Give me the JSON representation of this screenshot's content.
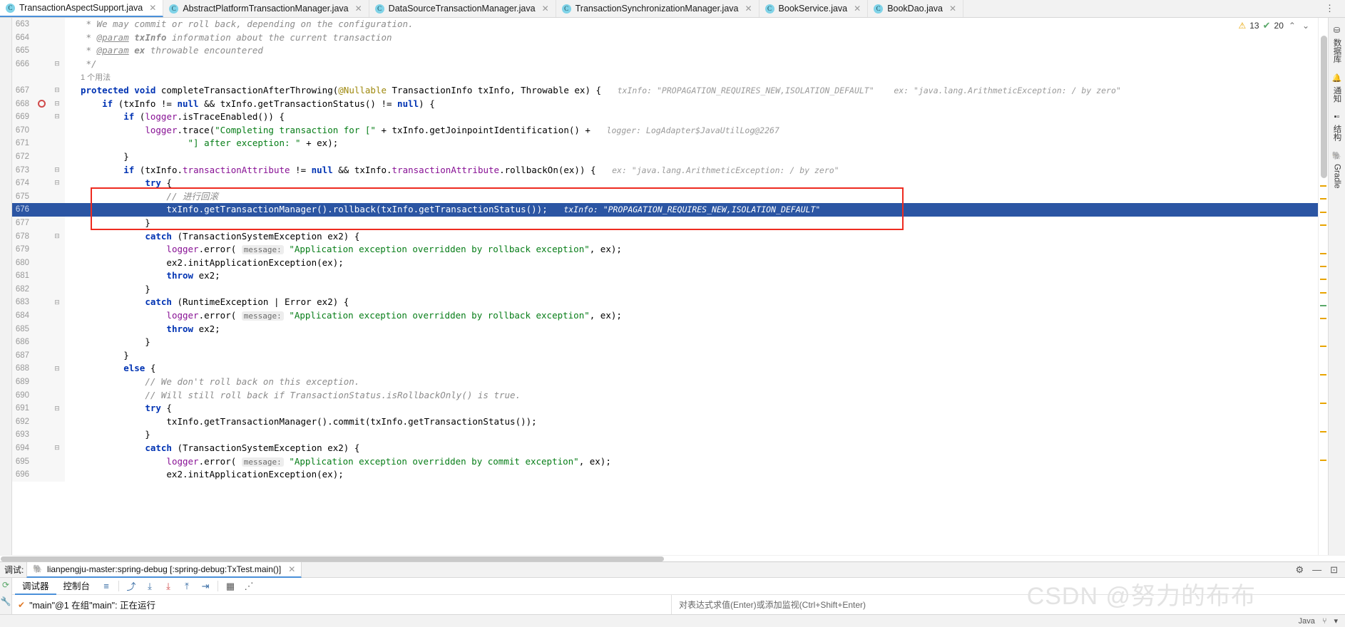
{
  "tabs": [
    {
      "label": "TransactionAspectSupport.java",
      "icon": "java-class-icon",
      "active": true
    },
    {
      "label": "AbstractPlatformTransactionManager.java",
      "icon": "java-class-icon",
      "active": false
    },
    {
      "label": "DataSourceTransactionManager.java",
      "icon": "java-class-icon",
      "active": false
    },
    {
      "label": "TransactionSynchronizationManager.java",
      "icon": "java-class-icon",
      "active": false
    },
    {
      "label": "BookService.java",
      "icon": "java-class-icon",
      "active": false
    },
    {
      "label": "BookDao.java",
      "icon": "java-class-icon",
      "active": false
    }
  ],
  "inspection": {
    "warning_count": "13",
    "check_count": "20",
    "warning_icon": "warning-triangle-icon",
    "check_icon": "green-check-icon",
    "prev_icon": "chevron-up-icon",
    "next_icon": "chevron-down-icon"
  },
  "right_rail": [
    {
      "label": "数据库",
      "icon": "database-icon"
    },
    {
      "label": "通知",
      "icon": "bell-icon"
    },
    {
      "label": "结构",
      "icon": "structure-icon"
    },
    {
      "label": "Gradle",
      "icon": "gradle-elephant-icon"
    }
  ],
  "editor": {
    "usage_hint": "1 个用法",
    "lines": [
      {
        "num": "663",
        "fold": "",
        "bp": false,
        "hl": false,
        "indent": 0,
        "html": "<span class=\"doc\"> * We may commit or roll back, depending on the configuration.</span>"
      },
      {
        "num": "664",
        "fold": "",
        "bp": false,
        "hl": false,
        "indent": 0,
        "html": "<span class=\"doc\"> * <span class=\"param-u\">@param</span> <b>txInfo</b> information about the current transaction</span>"
      },
      {
        "num": "665",
        "fold": "",
        "bp": false,
        "hl": false,
        "indent": 0,
        "html": "<span class=\"doc\"> * <span class=\"param-u\">@param</span> <b>ex</b> throwable encountered</span>"
      },
      {
        "num": "666",
        "fold": "minus",
        "bp": false,
        "hl": false,
        "indent": 0,
        "html": "<span class=\"doc\"> */</span>"
      },
      {
        "num": "",
        "fold": "",
        "bp": false,
        "hl": false,
        "indent": 0,
        "usage": true,
        "html": "<span class=\"usage\">1 个用法</span>"
      },
      {
        "num": "667",
        "fold": "minus",
        "bp": false,
        "hl": false,
        "indent": 0,
        "html": "<span class=\"kw\">protected</span> <span class=\"kw\">void</span> <span class=\"mth\">completeTransactionAfterThrowing</span>(<span class=\"anno\">@Nullable</span> TransactionInfo txInfo, Throwable ex) {   <span class=\"hint\">txInfo: \"PROPAGATION_REQUIRES_NEW,ISOLATION_DEFAULT\"    ex: \"java.lang.ArithmeticException: / by zero\"</span>"
      },
      {
        "num": "668",
        "fold": "minus",
        "bp": true,
        "hl": false,
        "indent": 1,
        "html": "    <span class=\"kw\">if</span> (txInfo != <span class=\"kw\">null</span> &amp;&amp; txInfo.getTransactionStatus() != <span class=\"kw\">null</span>) {"
      },
      {
        "num": "669",
        "fold": "minus",
        "bp": false,
        "hl": false,
        "indent": 2,
        "html": "        <span class=\"kw\">if</span> (<span class=\"fld\">logger</span>.isTraceEnabled()) {"
      },
      {
        "num": "670",
        "fold": "",
        "bp": false,
        "hl": false,
        "indent": 3,
        "html": "            <span class=\"fld\">logger</span>.trace(<span class=\"str\">\"Completing transaction for [\"</span> + txInfo.getJoinpointIdentification() +   <span class=\"hint\">logger: LogAdapter$JavaUtilLog@2267</span>"
      },
      {
        "num": "671",
        "fold": "",
        "bp": false,
        "hl": false,
        "indent": 3,
        "html": "                    <span class=\"str\">\"] after exception: \"</span> + ex);"
      },
      {
        "num": "672",
        "fold": "",
        "bp": false,
        "hl": false,
        "indent": 2,
        "html": "        }"
      },
      {
        "num": "673",
        "fold": "minus",
        "bp": false,
        "hl": false,
        "indent": 2,
        "html": "        <span class=\"kw\">if</span> (txInfo.<span class=\"fld\">transactionAttribute</span> != <span class=\"kw\">null</span> &amp;&amp; txInfo.<span class=\"fld\">transactionAttribute</span>.rollbackOn(ex)) {   <span class=\"hint\">ex: \"java.lang.ArithmeticException: / by zero\"</span>"
      },
      {
        "num": "674",
        "fold": "minus",
        "bp": false,
        "hl": false,
        "indent": 3,
        "html": "            <span class=\"kw\">try</span> {"
      },
      {
        "num": "675",
        "fold": "",
        "bp": false,
        "hl": false,
        "indent": 4,
        "html": "                <span class=\"cmt\">// 进行回滚</span>"
      },
      {
        "num": "676",
        "fold": "",
        "bp": false,
        "hl": true,
        "indent": 4,
        "html": "                txInfo.getTransactionManager().rollback(txInfo.getTransactionStatus());   <span class=\"hint\">txInfo: \"PROPAGATION_REQUIRES_NEW,ISOLATION_DEFAULT\"</span>"
      },
      {
        "num": "677",
        "fold": "",
        "bp": false,
        "hl": false,
        "indent": 3,
        "html": "            }"
      },
      {
        "num": "678",
        "fold": "minus",
        "bp": false,
        "hl": false,
        "indent": 3,
        "html": "            <span class=\"kw\">catch</span> (TransactionSystemException ex2) {"
      },
      {
        "num": "679",
        "fold": "",
        "bp": false,
        "hl": false,
        "indent": 4,
        "html": "                <span class=\"fld\">logger</span>.error( <span class=\"hintbox\">message:</span> <span class=\"str\">\"Application exception overridden by rollback exception\"</span>, ex);"
      },
      {
        "num": "680",
        "fold": "",
        "bp": false,
        "hl": false,
        "indent": 4,
        "html": "                ex2.initApplicationException(ex);"
      },
      {
        "num": "681",
        "fold": "",
        "bp": false,
        "hl": false,
        "indent": 4,
        "html": "                <span class=\"kw\">throw</span> ex2;"
      },
      {
        "num": "682",
        "fold": "",
        "bp": false,
        "hl": false,
        "indent": 3,
        "html": "            }"
      },
      {
        "num": "683",
        "fold": "minus",
        "bp": false,
        "hl": false,
        "indent": 3,
        "html": "            <span class=\"kw\">catch</span> (RuntimeException | Error ex2) {"
      },
      {
        "num": "684",
        "fold": "",
        "bp": false,
        "hl": false,
        "indent": 4,
        "html": "                <span class=\"fld\">logger</span>.error( <span class=\"hintbox\">message:</span> <span class=\"str\">\"Application exception overridden by rollback exception\"</span>, ex);"
      },
      {
        "num": "685",
        "fold": "",
        "bp": false,
        "hl": false,
        "indent": 4,
        "html": "                <span class=\"kw\">throw</span> ex2;"
      },
      {
        "num": "686",
        "fold": "",
        "bp": false,
        "hl": false,
        "indent": 3,
        "html": "            }"
      },
      {
        "num": "687",
        "fold": "",
        "bp": false,
        "hl": false,
        "indent": 2,
        "html": "        }"
      },
      {
        "num": "688",
        "fold": "minus",
        "bp": false,
        "hl": false,
        "indent": 2,
        "html": "        <span class=\"kw\">else</span> {"
      },
      {
        "num": "689",
        "fold": "",
        "bp": false,
        "hl": false,
        "indent": 3,
        "html": "            <span class=\"cmt\">// We don't roll back on this exception.</span>"
      },
      {
        "num": "690",
        "fold": "",
        "bp": false,
        "hl": false,
        "indent": 3,
        "html": "            <span class=\"cmt\">// Will still roll back if TransactionStatus.isRollbackOnly() is true.</span>"
      },
      {
        "num": "691",
        "fold": "minus",
        "bp": false,
        "hl": false,
        "indent": 3,
        "html": "            <span class=\"kw\">try</span> {"
      },
      {
        "num": "692",
        "fold": "",
        "bp": false,
        "hl": false,
        "indent": 4,
        "html": "                txInfo.getTransactionManager().commit(txInfo.getTransactionStatus());"
      },
      {
        "num": "693",
        "fold": "",
        "bp": false,
        "hl": false,
        "indent": 3,
        "html": "            }"
      },
      {
        "num": "694",
        "fold": "minus",
        "bp": false,
        "hl": false,
        "indent": 3,
        "html": "            <span class=\"kw\">catch</span> (TransactionSystemException ex2) {"
      },
      {
        "num": "695",
        "fold": "",
        "bp": false,
        "hl": false,
        "indent": 4,
        "html": "                <span class=\"fld\">logger</span>.error( <span class=\"hintbox\">message:</span> <span class=\"str\">\"Application exception overridden by commit exception\"</span>, ex);"
      },
      {
        "num": "696",
        "fold": "",
        "bp": false,
        "hl": false,
        "indent": 4,
        "html": "                ex2.initApplicationException(ex);"
      }
    ]
  },
  "debug": {
    "panel_label": "调试:",
    "session_title": "lianpengju-master:spring-debug [:spring-debug:TxTest.main()]",
    "session_close_icon": "close-icon",
    "settings_icon": "gear-icon",
    "minimize_icon": "minimize-icon",
    "hide_icon": "hide-icon",
    "tabs": [
      {
        "label": "调试器",
        "active": true
      },
      {
        "label": "控制台",
        "active": false
      }
    ],
    "toolbar_icons": [
      {
        "name": "frames-layout-icon",
        "glyph": "≡"
      },
      {
        "name": "step-over-icon",
        "glyph": "⤴"
      },
      {
        "name": "step-into-icon",
        "glyph": "⭳"
      },
      {
        "name": "force-step-into-icon",
        "glyph": "⭳"
      },
      {
        "name": "step-out-icon",
        "glyph": "⭱"
      },
      {
        "name": "run-to-cursor-icon",
        "glyph": "⭷"
      },
      {
        "name": "evaluate-expression-icon",
        "glyph": "▦"
      },
      {
        "name": "mute-breakpoints-icon",
        "glyph": "≭"
      }
    ],
    "left_rail_icons": [
      {
        "name": "rerun-icon",
        "glyph": "⟳"
      },
      {
        "name": "settings-wrench-icon",
        "glyph": "🔧"
      }
    ],
    "thread_status": "\"main\"@1 在组\"main\": 正在运行",
    "thread_status_icon": "orange-check-icon",
    "filter_icon": "filter-funnel-icon",
    "filter_dropdown_icon": "chevron-down-icon",
    "watch_placeholder": "对表达式求值(Enter)或添加监视(Ctrl+Shift+Enter)"
  },
  "statusbar": {
    "language": "Java",
    "indicator_icon": "branch-icon",
    "dropdown_icon": "chevron-down-icon"
  },
  "watermark": "CSDN @努力的布布"
}
